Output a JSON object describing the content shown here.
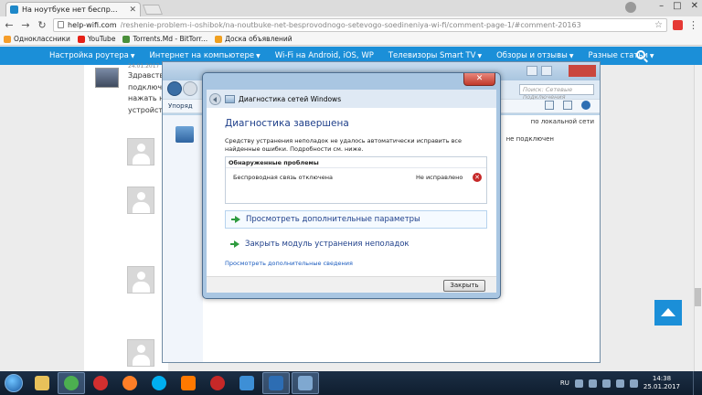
{
  "browser": {
    "tab_title": "На ноутбуке нет беспр...",
    "url_host": "help-wifi.com",
    "url_path": "/reshenie-problem-i-oshibok/na-noutbuke-net-besprovodnogo-setevogo-soedineniya-wi-fi/comment-page-1/#comment-20163",
    "bookmarks": [
      {
        "label": "Одноклассники",
        "color": "#f59d2a"
      },
      {
        "label": "YouTube",
        "color": "#e62117"
      },
      {
        "label": "Torrents.Md - BitTorr...",
        "color": "#4a8f3a"
      },
      {
        "label": "Доска объявлений",
        "color": "#f0a020"
      }
    ]
  },
  "site_nav": {
    "items": [
      {
        "label": "Настройка роутера",
        "has_arrow": true
      },
      {
        "label": "Интернет на компьютере",
        "has_arrow": true
      },
      {
        "label": "Wi-Fi на Android, iOS, WP",
        "has_arrow": false
      },
      {
        "label": "Телевизоры Smart TV",
        "has_arrow": true
      },
      {
        "label": "Обзоры и отзывы",
        "has_arrow": true
      },
      {
        "label": "Разные статьи",
        "has_arrow": true
      }
    ]
  },
  "comment": {
    "date": "24.01.2017",
    "lines": [
      "Здравству",
      "подключе",
      "нажать на",
      "устройств,"
    ]
  },
  "netwin": {
    "toolbar_label": "Упоряд",
    "search_placeholder": "Поиск: Сетевые подключения",
    "right_text_1": "по локальной сети",
    "right_text_2": "не подключен"
  },
  "dialog": {
    "window_title": "Диагностика сетей Windows",
    "heading": "Диагностика завершена",
    "description": "Средству устранения неполадок не удалось автоматически исправить все найденные ошибки. Подробности см. ниже.",
    "problems_header": "Обнаруженные проблемы",
    "problem_name": "Беспроводная связь отключена",
    "problem_status": "Не исправлено",
    "link_view_options": "Просмотреть дополнительные параметры",
    "link_close_module": "Закрыть модуль устранения неполадок",
    "link_details": "Просмотреть дополнительные сведения",
    "close_button": "Закрыть"
  },
  "taskbar": {
    "apps": [
      {
        "name": "explorer",
        "color": "#e8c15a"
      },
      {
        "name": "chrome",
        "color": "#4caf50"
      },
      {
        "name": "opera",
        "color": "#d32f2f"
      },
      {
        "name": "firefox",
        "color": "#ff7f27"
      },
      {
        "name": "skype",
        "color": "#00aff0"
      },
      {
        "name": "orange",
        "color": "#ff7900"
      },
      {
        "name": "app-red",
        "color": "#c62828"
      },
      {
        "name": "paint",
        "color": "#3d8fd6"
      },
      {
        "name": "network-monitor",
        "color": "#2d6db3"
      },
      {
        "name": "network-diagnostics",
        "color": "#7fa8d0"
      }
    ],
    "language": "RU",
    "time": "14:38",
    "date": "25.01.2017"
  }
}
